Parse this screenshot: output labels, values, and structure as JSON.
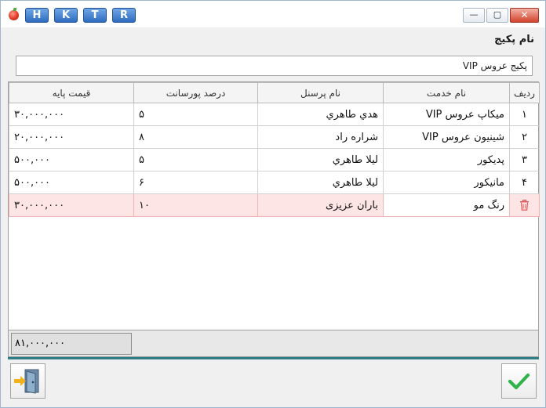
{
  "titlebar": {
    "shortcut_buttons": [
      "H",
      "K",
      "T",
      "R"
    ],
    "minimize_glyph": "—",
    "maximize_glyph": "▢",
    "close_glyph": "✕"
  },
  "package": {
    "label": "نام پکیج",
    "value": "پکیج عروس VIP"
  },
  "grid": {
    "columns": {
      "row": "ردیف",
      "service": "نام خدمت",
      "staff": "نام پرسنل",
      "percent": "درصد پورسانت",
      "price": "قیمت پایه"
    },
    "rows": [
      {
        "row": "۱",
        "service": "میکاپ عروس VIP",
        "staff": "هدي طاهري",
        "percent": "۵",
        "price": "۳۰,۰۰۰,۰۰۰"
      },
      {
        "row": "۲",
        "service": "شینیون عروس VIP",
        "staff": "شراره راد",
        "percent": "۸",
        "price": "۲۰,۰۰۰,۰۰۰"
      },
      {
        "row": "۳",
        "service": "پدیکور",
        "staff": "ليلا طاهري",
        "percent": "۵",
        "price": "۵۰۰,۰۰۰"
      },
      {
        "row": "۴",
        "service": "مانیکور",
        "staff": "ليلا طاهري",
        "percent": "۶",
        "price": "۵۰۰,۰۰۰"
      }
    ],
    "new_row": {
      "service": "رنگ مو",
      "staff": "باران عزیزی",
      "percent": "۱۰",
      "price": "۳۰,۰۰۰,۰۰۰"
    }
  },
  "summary": {
    "total": "۸۱,۰۰۰,۰۰۰"
  },
  "icons": {
    "exit": "exit-door-icon",
    "ok": "checkmark-icon",
    "delete": "trash-icon",
    "app": "app-logo-icon"
  },
  "colors": {
    "accent_teal": "#2f7d85",
    "new_row_bg": "#fde5e5",
    "check_green": "#2fb34a",
    "trash_red": "#e05050"
  }
}
